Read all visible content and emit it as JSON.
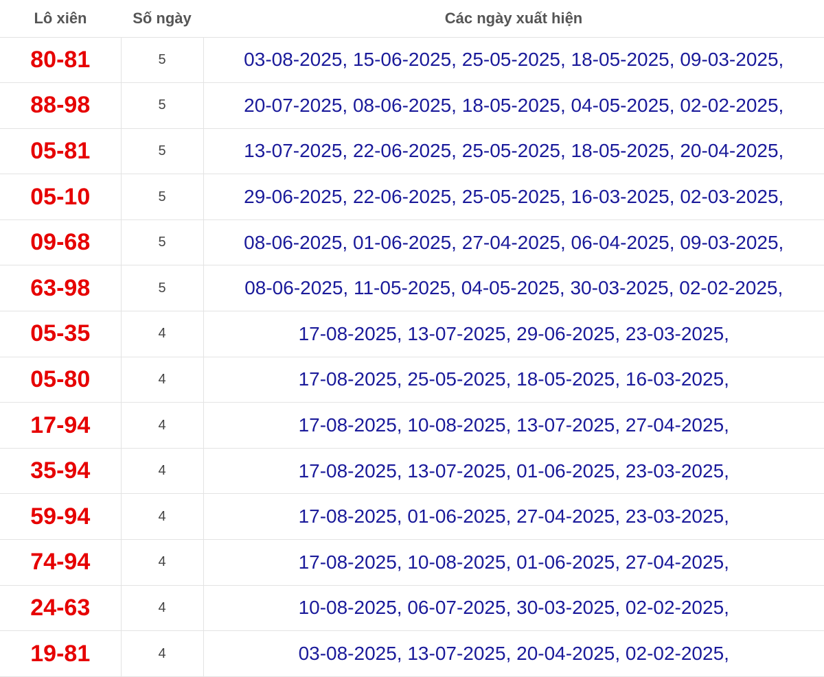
{
  "header": {
    "col_pair": "Lô xiên",
    "col_count": "Số ngày",
    "col_dates": "Các ngày xuất hiện"
  },
  "rows": [
    {
      "pair": "80-81",
      "count": "5",
      "dates": "03-08-2025, 15-06-2025, 25-05-2025, 18-05-2025, 09-03-2025,"
    },
    {
      "pair": "88-98",
      "count": "5",
      "dates": "20-07-2025, 08-06-2025, 18-05-2025, 04-05-2025, 02-02-2025,"
    },
    {
      "pair": "05-81",
      "count": "5",
      "dates": "13-07-2025, 22-06-2025, 25-05-2025, 18-05-2025, 20-04-2025,"
    },
    {
      "pair": "05-10",
      "count": "5",
      "dates": "29-06-2025, 22-06-2025, 25-05-2025, 16-03-2025, 02-03-2025,"
    },
    {
      "pair": "09-68",
      "count": "5",
      "dates": "08-06-2025, 01-06-2025, 27-04-2025, 06-04-2025, 09-03-2025,"
    },
    {
      "pair": "63-98",
      "count": "5",
      "dates": "08-06-2025, 11-05-2025, 04-05-2025, 30-03-2025, 02-02-2025,"
    },
    {
      "pair": "05-35",
      "count": "4",
      "dates": "17-08-2025, 13-07-2025, 29-06-2025, 23-03-2025,"
    },
    {
      "pair": "05-80",
      "count": "4",
      "dates": "17-08-2025, 25-05-2025, 18-05-2025, 16-03-2025,"
    },
    {
      "pair": "17-94",
      "count": "4",
      "dates": "17-08-2025, 10-08-2025, 13-07-2025, 27-04-2025,"
    },
    {
      "pair": "35-94",
      "count": "4",
      "dates": "17-08-2025, 13-07-2025, 01-06-2025, 23-03-2025,"
    },
    {
      "pair": "59-94",
      "count": "4",
      "dates": "17-08-2025, 01-06-2025, 27-04-2025, 23-03-2025,"
    },
    {
      "pair": "74-94",
      "count": "4",
      "dates": "17-08-2025, 10-08-2025, 01-06-2025, 27-04-2025,"
    },
    {
      "pair": "24-63",
      "count": "4",
      "dates": "10-08-2025, 06-07-2025, 30-03-2025, 02-02-2025,"
    },
    {
      "pair": "19-81",
      "count": "4",
      "dates": "03-08-2025, 13-07-2025, 20-04-2025, 02-02-2025,"
    }
  ]
}
